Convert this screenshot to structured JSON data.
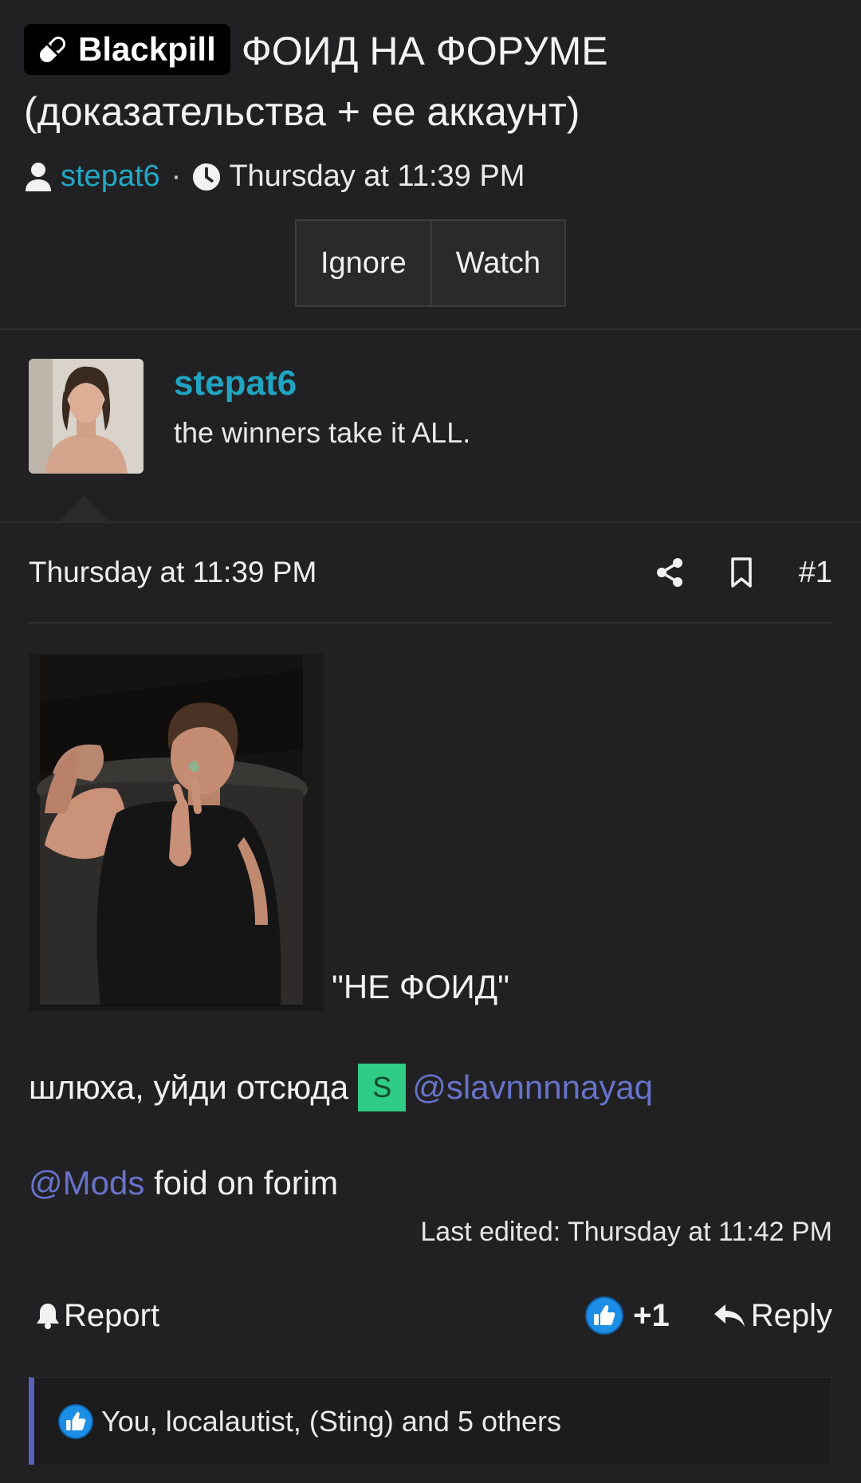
{
  "thread": {
    "prefix": "Blackpill",
    "title": "ФОИД НА ФОРУМЕ (доказательства + ее аккаунт)",
    "author": "stepat6",
    "separator": "·",
    "date": "Thursday at 11:39 PM",
    "actions": {
      "ignore": "Ignore",
      "watch": "Watch"
    }
  },
  "post": {
    "username": "stepat6",
    "user_title": "the winners take it ALL.",
    "date": "Thursday at 11:39 PM",
    "number": "#1",
    "image_caption": "\"НЕ ФОИД\"",
    "line2_text": "шлюха, уйди отсюда",
    "line2_avatar_letter": "S",
    "line2_mention": "@slavnnnnayaq",
    "line3_mention": "@Mods",
    "line3_text": " foid on forim",
    "last_edited": "Last edited: Thursday at 11:42 PM",
    "footer": {
      "report": "Report",
      "reaction_count": "+1",
      "reply": "Reply"
    },
    "reactions_summary": "You, localautist, (Sting) and 5 others"
  },
  "colors": {
    "background": "#212123",
    "link_teal": "#1fa4c2",
    "mention_purple": "#6773c9",
    "avatar_green": "#2ecc85",
    "reaction_accent": "#5b60b8"
  },
  "icons": [
    "pill-icon",
    "user-icon",
    "clock-icon",
    "share-icon",
    "bookmark-icon",
    "bell-icon",
    "like-icon",
    "reply-icon"
  ]
}
